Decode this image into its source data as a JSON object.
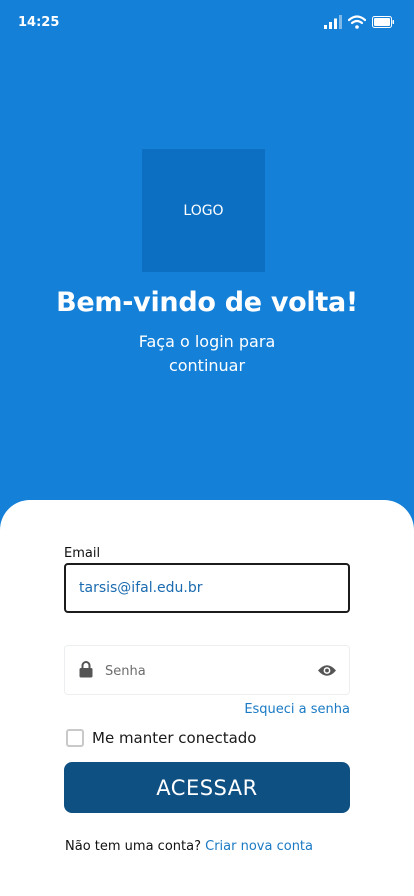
{
  "status_bar": {
    "time": "14:25",
    "icons": [
      "signal-icon",
      "wifi-icon",
      "battery-icon"
    ]
  },
  "header": {
    "logo_text": "LOGO",
    "title": "Bem-vindo de volta!",
    "subtitle": "Faça o login para continuar"
  },
  "form": {
    "email_label": "Email",
    "email_value": "tarsis@ifal.edu.br",
    "password_placeholder": "Senha",
    "forgot_password": "Esqueci a senha",
    "remember_me": "Me manter conectado",
    "remember_checked": false,
    "submit_label": "ACESSAR"
  },
  "footer": {
    "no_account_text": "Não tem uma conta?",
    "create_account_link": "Criar nova conta"
  },
  "colors": {
    "header_background": "#1580d8",
    "logo_background": "#0c6fc2",
    "button_background": "#0f5083",
    "link": "#1a7ac4"
  }
}
